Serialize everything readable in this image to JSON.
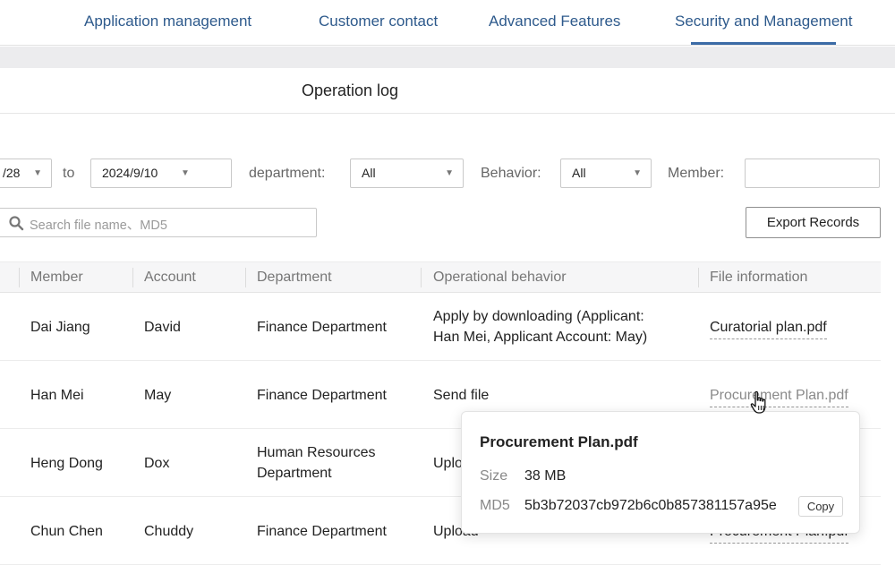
{
  "nav": {
    "tabs": [
      {
        "label": "Application management"
      },
      {
        "label": "Customer contact"
      },
      {
        "label": "Advanced Features"
      },
      {
        "label": "Security and Management",
        "active": true
      }
    ]
  },
  "page": {
    "title": "Operation log"
  },
  "filters": {
    "date_from": "/28",
    "to_label": "to",
    "date_to": "2024/9/10",
    "department_label": "department:",
    "department_value": "All",
    "behavior_label": "Behavior:",
    "behavior_value": "All",
    "member_label": "Member:",
    "member_value": "",
    "search_placeholder": "Search file name、MD5",
    "export_label": "Export Records"
  },
  "table": {
    "columns": [
      "Member",
      "Account",
      "Department",
      "Operational behavior",
      "File information"
    ],
    "rows": [
      {
        "member": "Dai Jiang",
        "account": "David",
        "department": "Finance Department",
        "behavior_line1": "Apply by downloading (Applicant:",
        "behavior_line2": "Han Mei, Applicant Account: May)",
        "file": "Curatorial plan.pdf"
      },
      {
        "member": "Han Mei",
        "account": "May",
        "department": "Finance Department",
        "behavior_line1": "Send file",
        "file": "Procurement Plan.pdf"
      },
      {
        "member": "Heng Dong",
        "account": "Dox",
        "department_line1": "Human Resources",
        "department_line2": "Department",
        "behavior_line1": "Uplo",
        "file": ""
      },
      {
        "member": "Chun Chen",
        "account": "Chuddy",
        "department": "Finance Department",
        "behavior_line1": "Upload",
        "file": "Procurement Plan.pdf"
      }
    ]
  },
  "popover": {
    "title": "Procurement Plan.pdf",
    "size_label": "Size",
    "size_value": "38 MB",
    "md5_label": "MD5",
    "md5_value": "5b3b72037cb972b6c0b857381157a95e",
    "copy_label": "Copy"
  },
  "colors": {
    "accent": "#3b6ba6",
    "nav_text": "#2e5a8c"
  }
}
